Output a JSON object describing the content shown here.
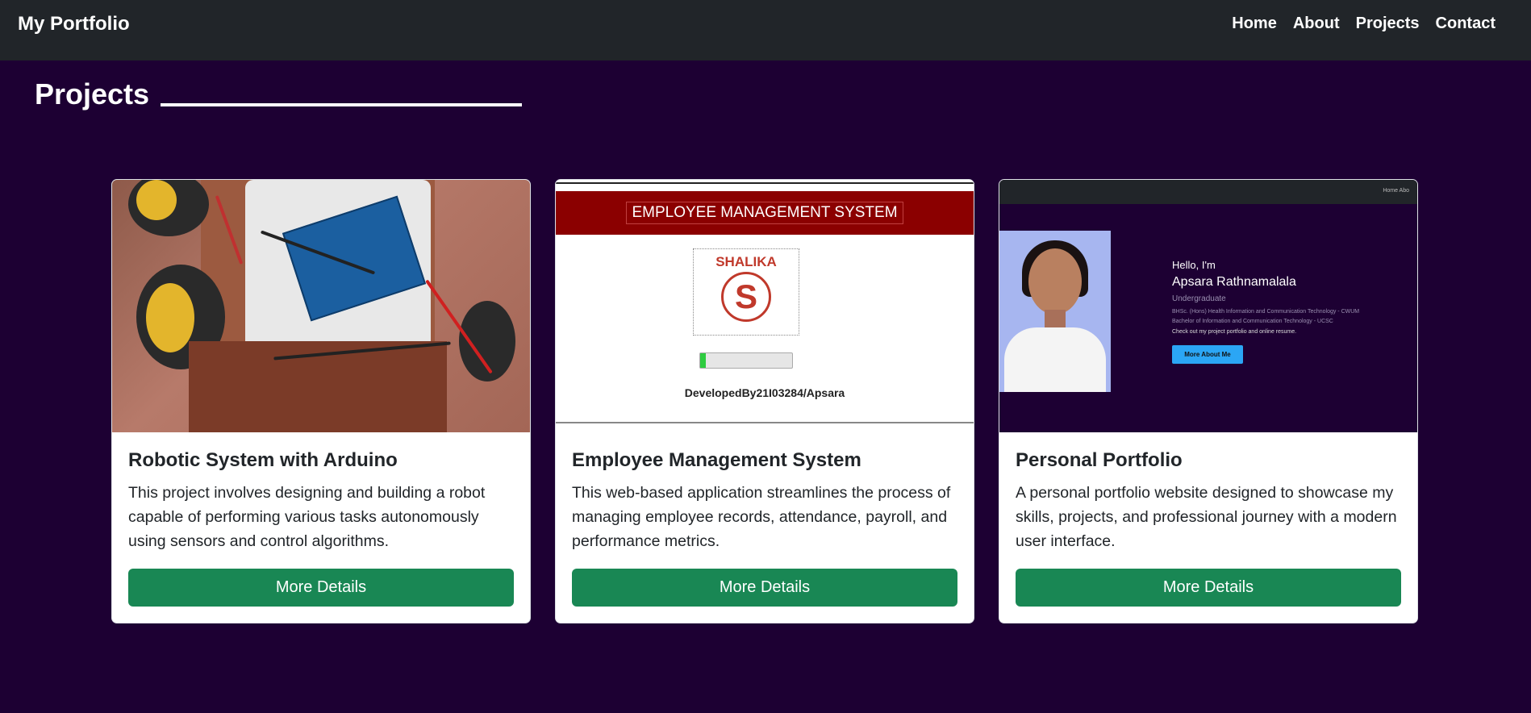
{
  "navbar": {
    "brand": "My Portfolio",
    "links": [
      "Home",
      "About",
      "Projects",
      "Contact"
    ]
  },
  "section": {
    "title": "Projects"
  },
  "projects": [
    {
      "title": "Robotic System with Arduino",
      "description": "This project involves designing and building a robot capable of performing various tasks autonomously using sensors and control algorithms.",
      "button": "More Details"
    },
    {
      "title": "Employee Management System",
      "description": "This web-based application streamlines the process of managing employee records, attendance, payroll, and performance metrics.",
      "button": "More Details",
      "image": {
        "banner": "EMPLOYEE MANAGEMENT SYSTEM",
        "logo_name": "SHALIKA",
        "logo_letter": "S",
        "credit": "DevelopedBy21I03284/Apsara"
      }
    },
    {
      "title": "Personal Portfolio",
      "description": "A personal portfolio website designed to showcase my skills, projects, and professional journey with a modern user interface.",
      "button": "More Details",
      "image": {
        "nav_links": "Home   Abo",
        "hello": "Hello, I'm",
        "name": "Apsara Rathnamalala",
        "role": "Undergraduate",
        "degree1": "BHSc. (Hons) Health Information and Communication Technology - CWUM",
        "degree2": "Bachelor of Information and Communication Technology - UCSC",
        "check": "Check out my project portfolio and online resume.",
        "button": "More About Me"
      }
    }
  ],
  "colors": {
    "page_bg": "#1d0033",
    "navbar_bg": "#212529",
    "button_bg": "#198754"
  }
}
